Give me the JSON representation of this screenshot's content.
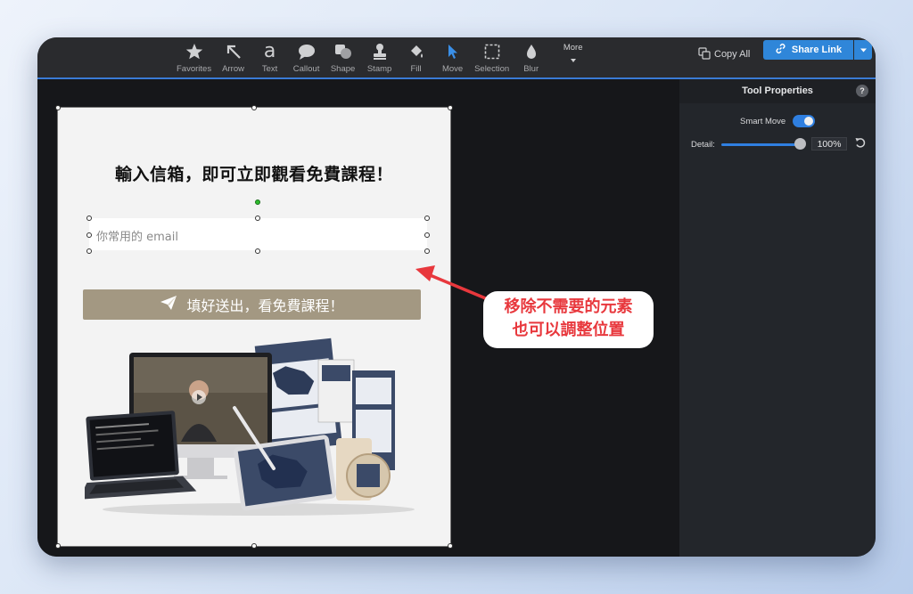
{
  "toolbar": {
    "tools": [
      {
        "label": "Favorites",
        "icon": "star-icon"
      },
      {
        "label": "Arrow",
        "icon": "arrow-icon"
      },
      {
        "label": "Text",
        "icon": "text-icon"
      },
      {
        "label": "Callout",
        "icon": "callout-icon"
      },
      {
        "label": "Shape",
        "icon": "shape-icon"
      },
      {
        "label": "Stamp",
        "icon": "stamp-icon"
      },
      {
        "label": "Fill",
        "icon": "fill-icon"
      },
      {
        "label": "Move",
        "icon": "move-icon"
      },
      {
        "label": "Selection",
        "icon": "selection-icon"
      },
      {
        "label": "Blur",
        "icon": "blur-icon"
      }
    ],
    "text_glyph": "a",
    "more_label": "More",
    "copy_all_label": "Copy All",
    "share_link_label": "Share Link"
  },
  "document": {
    "title": "輸入信箱，即可立即觀看免費課程！",
    "email_placeholder": "你常用的 email",
    "submit_label": "填好送出，看免費課程！"
  },
  "callout": {
    "line1": "移除不需要的元素",
    "line2": "也可以調整位置"
  },
  "panel": {
    "title": "Tool Properties",
    "help": "?",
    "smart_move_label": "Smart Move",
    "smart_move_on": true,
    "detail_label": "Detail:",
    "detail_percent": "100%",
    "detail_value": 1.0
  },
  "colors": {
    "accent": "#2f86d9",
    "callout_text": "#e8383d",
    "submit_bg": "#a39882",
    "rotation_handle": "#2ebd2e"
  }
}
